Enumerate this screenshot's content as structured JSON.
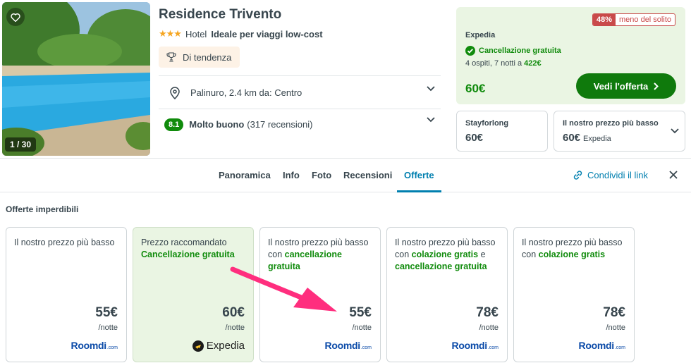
{
  "gallery": {
    "counter": "1 / 30"
  },
  "hotel": {
    "name": "Residence Trivento",
    "stars": "★★★",
    "type": "Hotel",
    "tagline": "Ideale per viaggi low-cost",
    "trend_label": "Di tendenza",
    "location": "Palinuro, 2.4 km da: Centro",
    "rating_score": "8.1",
    "rating_label": "Molto buono",
    "reviews": "(317 recensioni)"
  },
  "deal": {
    "discount_pct": "48%",
    "discount_text": "meno del solito",
    "provider": "Expedia",
    "free_cancel": "Cancellazione gratuita",
    "stay_prefix": "4 ospiti, 7 notti a",
    "stay_total": "422€",
    "price": "60€",
    "cta": "Vedi l'offerta"
  },
  "alternatives": [
    {
      "name": "Stayforlong",
      "price": "60€",
      "source": ""
    },
    {
      "name": "Il nostro prezzo più basso",
      "price": "60€",
      "source": "Expedia"
    }
  ],
  "tabs": {
    "items": [
      "Panoramica",
      "Info",
      "Foto",
      "Recensioni",
      "Offerte"
    ],
    "active": "Offerte",
    "share": "Condividi il link"
  },
  "offers_section": {
    "title": "Offerte imperdibili",
    "unit": "/notte",
    "cards": [
      {
        "line1": "Il nostro prezzo più basso",
        "green1": "",
        "mid": "",
        "green2": "",
        "price": "55€",
        "logo": "Roomdi",
        "logo_suffix": ".com"
      },
      {
        "line1": "Prezzo raccomandato",
        "green1": "Cancellazione gratuita",
        "mid": "",
        "green2": "",
        "price": "60€",
        "logo": "Expedia",
        "logo_suffix": ""
      },
      {
        "line1": "Il nostro prezzo più basso con",
        "green1": "cancellazione gratuita",
        "mid": "",
        "green2": "",
        "price": "55€",
        "logo": "Roomdi",
        "logo_suffix": ".com"
      },
      {
        "line1": "Il nostro prezzo più basso con",
        "green1": "colazione gratis",
        "mid": "e",
        "green2": "cancellazione gratuita",
        "price": "78€",
        "logo": "Roomdi",
        "logo_suffix": ".com"
      },
      {
        "line1": "Il nostro prezzo più basso con",
        "green1": "colazione gratis",
        "mid": "",
        "green2": "",
        "price": "78€",
        "logo": "Roomdi",
        "logo_suffix": ".com"
      }
    ]
  },
  "colors": {
    "accent": "#007faf",
    "green": "#108b0c",
    "cta": "#0f7a0c",
    "annotation_arrow": "#ff2e7e"
  }
}
